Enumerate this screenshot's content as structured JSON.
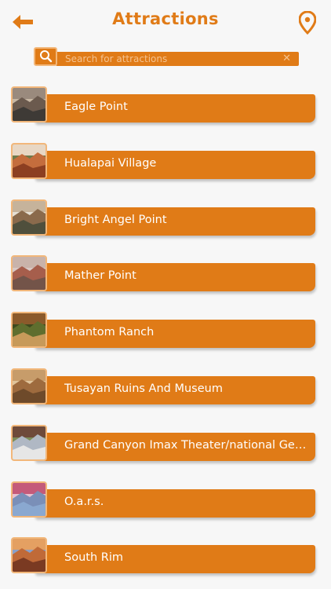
{
  "header": {
    "title": "Attractions",
    "back_icon": "back-arrow-icon",
    "location_icon": "map-pin-icon"
  },
  "search": {
    "placeholder": "Search for attractions",
    "value": "",
    "clear_label": "✕"
  },
  "colors": {
    "accent": "#e07b17",
    "accent_light": "#f2b77a",
    "background": "#f7f7f7"
  },
  "attractions": [
    {
      "name": "Eagle Point"
    },
    {
      "name": "Hualapai Village"
    },
    {
      "name": "Bright Angel Point"
    },
    {
      "name": "Mather Point"
    },
    {
      "name": "Phantom Ranch"
    },
    {
      "name": "Tusayan Ruins And Museum"
    },
    {
      "name": "Grand Canyon Imax Theater/national Geog..."
    },
    {
      "name": "O.a.r.s."
    },
    {
      "name": "South Rim"
    }
  ]
}
